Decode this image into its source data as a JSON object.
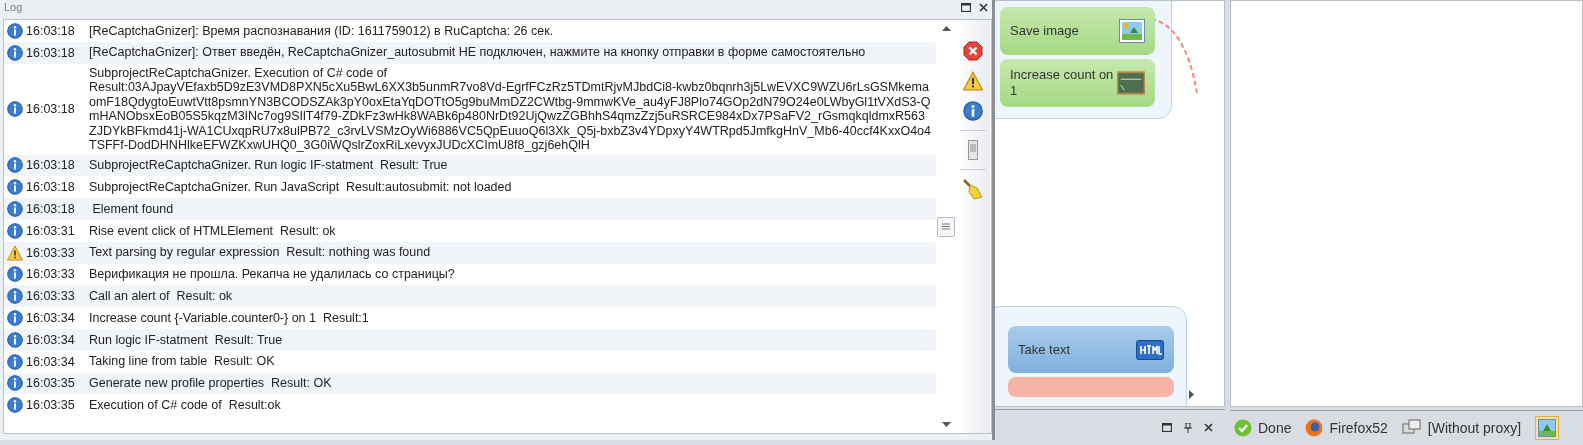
{
  "log": {
    "title": "Log",
    "entries": [
      {
        "kind": "info",
        "time": "16:03:18",
        "message": "[ReCaptchaGnizer]: Время распознавания (ID: 1611759012) в RuCaptcha: 26 сек."
      },
      {
        "kind": "info",
        "time": "16:03:18",
        "message": "[ReCaptchaGnizer]: Ответ введён, ReCaptchaGnizer_autosubmit НЕ подключен, нажмите на кнопку отправки в форме самостоятельно"
      },
      {
        "kind": "info",
        "time": "16:03:18",
        "message": "SubprojectReCaptchaGnizer. Execution of C# code of\nResult:03AJpayVEfaxb5D9zE3VMD8PXN5cXu5BwL6XX3b5unmR7vo8Vd-EgrfFCzRz5TDmtRjvMJbdCi8-kwbz0bqnrh3j5LwEVXC9WZU6rLsGSMkemaomF18QdygtoEuwtVtt8psmnYN3BCODSZAk3pY0oxEtaYqDOTtO5g9buMmDZ2CWtbg-9mmwKVe_au4yFJ8Plo74GOp2dN79O24e0LWbyGl1tVXdS3-QmHANObsxEoB05S5kqzM3INc7og9SIlT4f79-ZDkFz3wHk8WABk6p480NrDt92UjQwzZGBhhS4qmzZzj5uRSRCE984xDx7PSaFV2_rGsmqkqldmxR563ZJDYkBFkmd41j-WA1CUxqpRU7x8ulPB72_c3rvLVSMzOyWi6886VC5QpEuuoQ6l3Xk_Q5j-bxbZ3v4YDpxyY4WTRpd5JmfkgHnV_Mb6-40ccf4KxxO4o4TSFFf-DodDHNHlkeEFWZKxwUHQ0_3G0iWQslrZoxRiLxevyxJUDcXCImU8f8_gzj6ehQlH"
      },
      {
        "kind": "info",
        "time": "16:03:18",
        "message": "SubprojectReCaptchaGnizer. Run logic IF-statment  Result: True"
      },
      {
        "kind": "info",
        "time": "16:03:18",
        "message": "SubprojectReCaptchaGnizer. Run JavaScript  Result:autosubmit: not loaded"
      },
      {
        "kind": "info",
        "time": "16:03:18",
        "message": " Element found"
      },
      {
        "kind": "info",
        "time": "16:03:31",
        "message": "Rise event click of HTMLElement  Result: ok"
      },
      {
        "kind": "warning",
        "time": "16:03:33",
        "message": "Text parsing by regular expression  Result: nothing was found"
      },
      {
        "kind": "info",
        "time": "16:03:33",
        "message": "Верификация не прошла. Рекапча не удалилась со страницы?"
      },
      {
        "kind": "info",
        "time": "16:03:33",
        "message": "Call an alert of  Result: ok"
      },
      {
        "kind": "info",
        "time": "16:03:34",
        "message": "Increase count {-Variable.counter0-} on 1  Result:1"
      },
      {
        "kind": "info",
        "time": "16:03:34",
        "message": "Run logic IF-statment  Result: True"
      },
      {
        "kind": "info",
        "time": "16:03:34",
        "message": "Taking line from table  Result: OK"
      },
      {
        "kind": "info",
        "time": "16:03:35",
        "message": "Generate new profile properties  Result: OK"
      },
      {
        "kind": "info",
        "time": "16:03:35",
        "message": "Execution of C# code of  Result:ok"
      }
    ]
  },
  "canvas": {
    "nodes": [
      {
        "kind": "image",
        "label": "Save image"
      },
      {
        "kind": "counter",
        "label": "Increase count on 1"
      },
      {
        "kind": "html",
        "label": "Take text"
      },
      {
        "kind": "error"
      }
    ]
  },
  "status_bar": [
    {
      "kind": "done",
      "text": "Done"
    },
    {
      "kind": "browser",
      "text": "Firefox52"
    },
    {
      "kind": "proxy",
      "text": "[Without proxy]"
    },
    {
      "kind": "picture"
    }
  ]
}
